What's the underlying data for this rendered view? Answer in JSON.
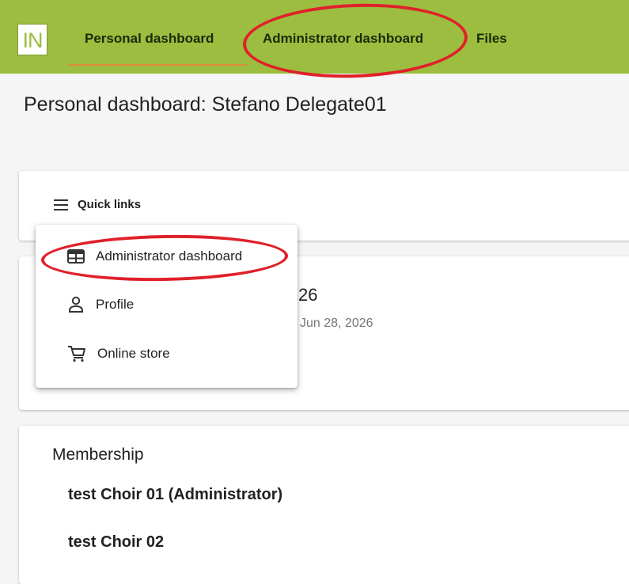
{
  "header": {
    "logo_text": "IN",
    "tabs": [
      {
        "label": "Personal dashboard",
        "active": true
      },
      {
        "label": "Administrator dashboard",
        "active": false
      },
      {
        "label": "Files",
        "active": false
      }
    ],
    "accent_color": "#9cbd3f",
    "active_underline_color": "#e08a3c"
  },
  "page": {
    "title": "Personal dashboard: Stefano Delegate01"
  },
  "quick_links": {
    "label": "Quick links",
    "icon": "menu-icon",
    "menu": [
      {
        "label": "Administrator dashboard",
        "icon": "table-icon"
      },
      {
        "label": "Profile",
        "icon": "person-icon"
      },
      {
        "label": "Online store",
        "icon": "cart-icon"
      }
    ]
  },
  "event_card": {
    "title_partial": "26",
    "date_partial": "Jun 28, 2026"
  },
  "membership": {
    "heading": "Membership",
    "items": [
      "test Choir 01 (Administrator)",
      "test Choir 02"
    ]
  },
  "annotation_color": "#e0202a"
}
